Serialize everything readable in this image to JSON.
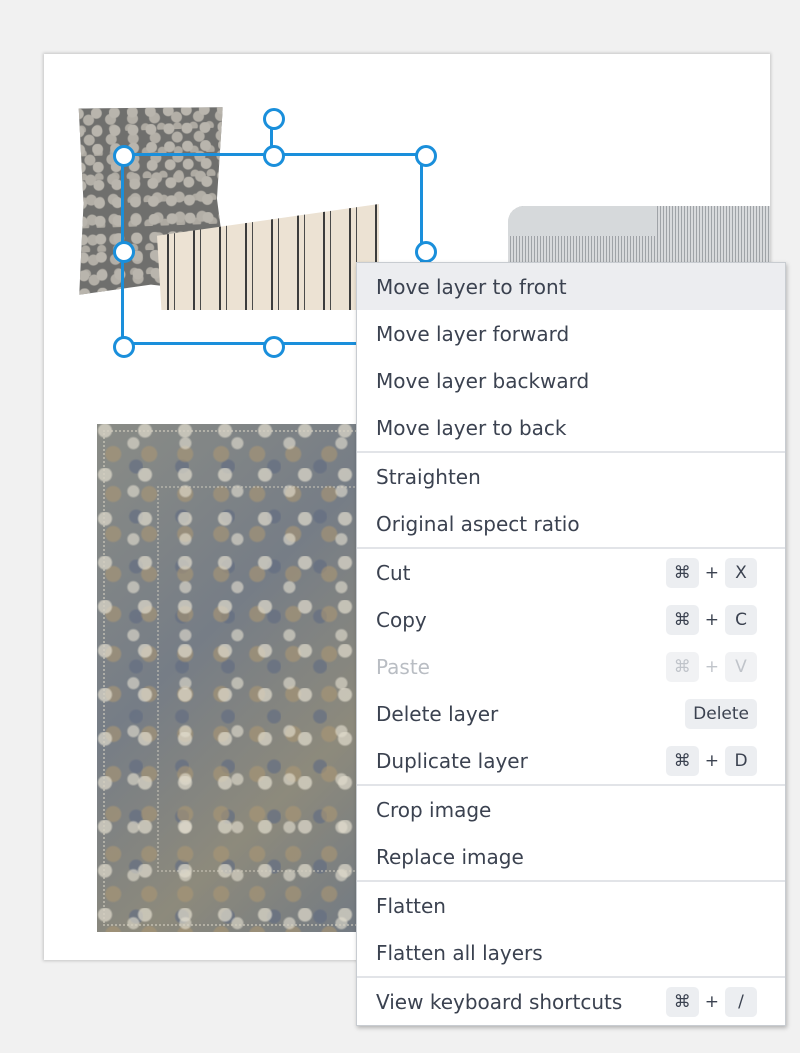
{
  "canvas": {
    "layers": [
      {
        "name": "grey-floral-pillow"
      },
      {
        "name": "striped-lumbar-pillow"
      },
      {
        "name": "striped-ottoman"
      },
      {
        "name": "vintage-blue-rug"
      }
    ],
    "selection_color": "#1a8fdb"
  },
  "context_menu": {
    "groups": [
      [
        {
          "label": "Move layer to front",
          "highlighted": true
        },
        {
          "label": "Move layer forward"
        },
        {
          "label": "Move layer backward"
        },
        {
          "label": "Move layer to back"
        }
      ],
      [
        {
          "label": "Straighten"
        },
        {
          "label": "Original aspect ratio"
        }
      ],
      [
        {
          "label": "Cut",
          "shortcut": [
            "⌘",
            "X"
          ]
        },
        {
          "label": "Copy",
          "shortcut": [
            "⌘",
            "C"
          ]
        },
        {
          "label": "Paste",
          "shortcut": [
            "⌘",
            "V"
          ],
          "disabled": true
        },
        {
          "label": "Delete layer",
          "shortcut": [
            "Delete"
          ]
        },
        {
          "label": "Duplicate layer",
          "shortcut": [
            "⌘",
            "D"
          ]
        }
      ],
      [
        {
          "label": "Crop image"
        },
        {
          "label": "Replace image"
        }
      ],
      [
        {
          "label": "Flatten"
        },
        {
          "label": "Flatten all layers"
        }
      ],
      [
        {
          "label": "View keyboard shortcuts",
          "shortcut": [
            "⌘",
            "/"
          ]
        }
      ]
    ],
    "plus_sign": "+"
  }
}
